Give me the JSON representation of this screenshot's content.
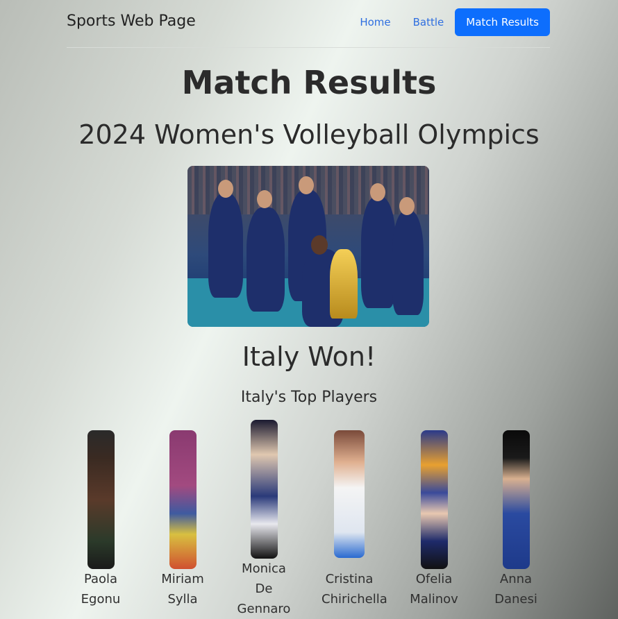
{
  "navbar": {
    "brand": "Sports Web Page",
    "links": [
      {
        "label": "Home"
      },
      {
        "label": "Battle"
      },
      {
        "label": "Match Results"
      }
    ]
  },
  "page": {
    "title": "Match Results",
    "subtitle": "2024 Women's Volleyball Olympics",
    "winner_text": "Italy Won!",
    "top_players_heading": "Italy's Top Players"
  },
  "players": [
    {
      "first": "Paola",
      "last": "Egonu"
    },
    {
      "first": "Miriam",
      "last": "Sylla"
    },
    {
      "first": "Monica",
      "middle": "De",
      "last": "Gennaro"
    },
    {
      "first": "Cristina",
      "last": "Chirichella"
    },
    {
      "first": "Ofelia",
      "last": "Malinov"
    },
    {
      "first": "Anna",
      "last": "Danesi"
    }
  ],
  "colors": {
    "accent": "#0d6efd",
    "link": "#2f6fe0"
  }
}
